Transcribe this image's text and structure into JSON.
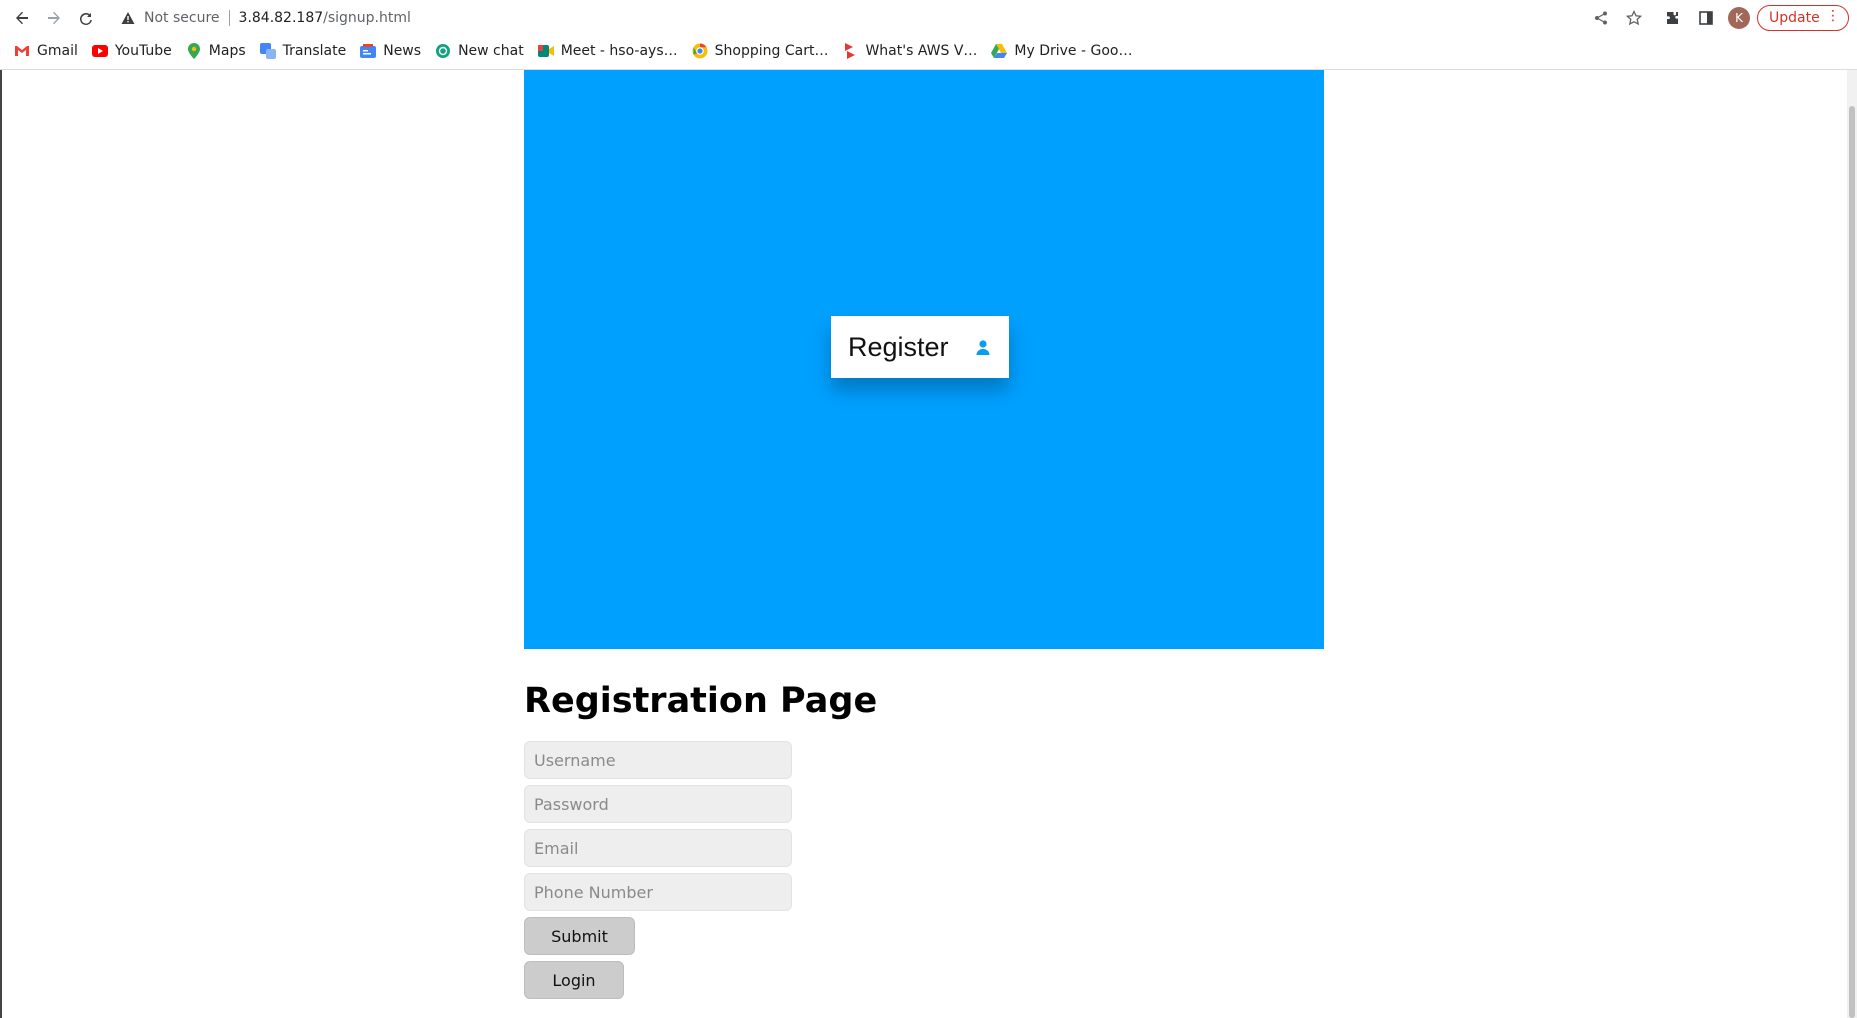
{
  "browser": {
    "not_secure_label": "Not secure",
    "url_host": "3.84.82.187",
    "url_path": "/signup.html",
    "avatar_letter": "K",
    "update_label": "Update",
    "bookmarks": [
      {
        "label": "Gmail",
        "icon": "gmail-icon",
        "color": "#ea4335"
      },
      {
        "label": "YouTube",
        "icon": "youtube-icon",
        "color": "#ff0000"
      },
      {
        "label": "Maps",
        "icon": "maps-icon",
        "color": "#34a853"
      },
      {
        "label": "Translate",
        "icon": "translate-icon",
        "color": "#4285f4"
      },
      {
        "label": "News",
        "icon": "news-icon",
        "color": "#4285f4"
      },
      {
        "label": "New chat",
        "icon": "chatgpt-icon",
        "color": "#10a37f"
      },
      {
        "label": "Meet - hso-ays…",
        "icon": "meet-icon",
        "color": "#00897b"
      },
      {
        "label": "Shopping Cart…",
        "icon": "chrome-icon",
        "color": "#fbbc05"
      },
      {
        "label": "What's AWS V…",
        "icon": "aws-icon",
        "color": "#e53935"
      },
      {
        "label": "My Drive - Goo…",
        "icon": "drive-icon",
        "color": "#1e88e5"
      }
    ]
  },
  "hero": {
    "register_label": "Register",
    "accent_color": "#00a0ff"
  },
  "form": {
    "title": "Registration Page",
    "username_placeholder": "Username",
    "password_placeholder": "Password",
    "email_placeholder": "Email",
    "phone_placeholder": "Phone Number",
    "submit_label": "Submit",
    "login_label": "Login"
  }
}
